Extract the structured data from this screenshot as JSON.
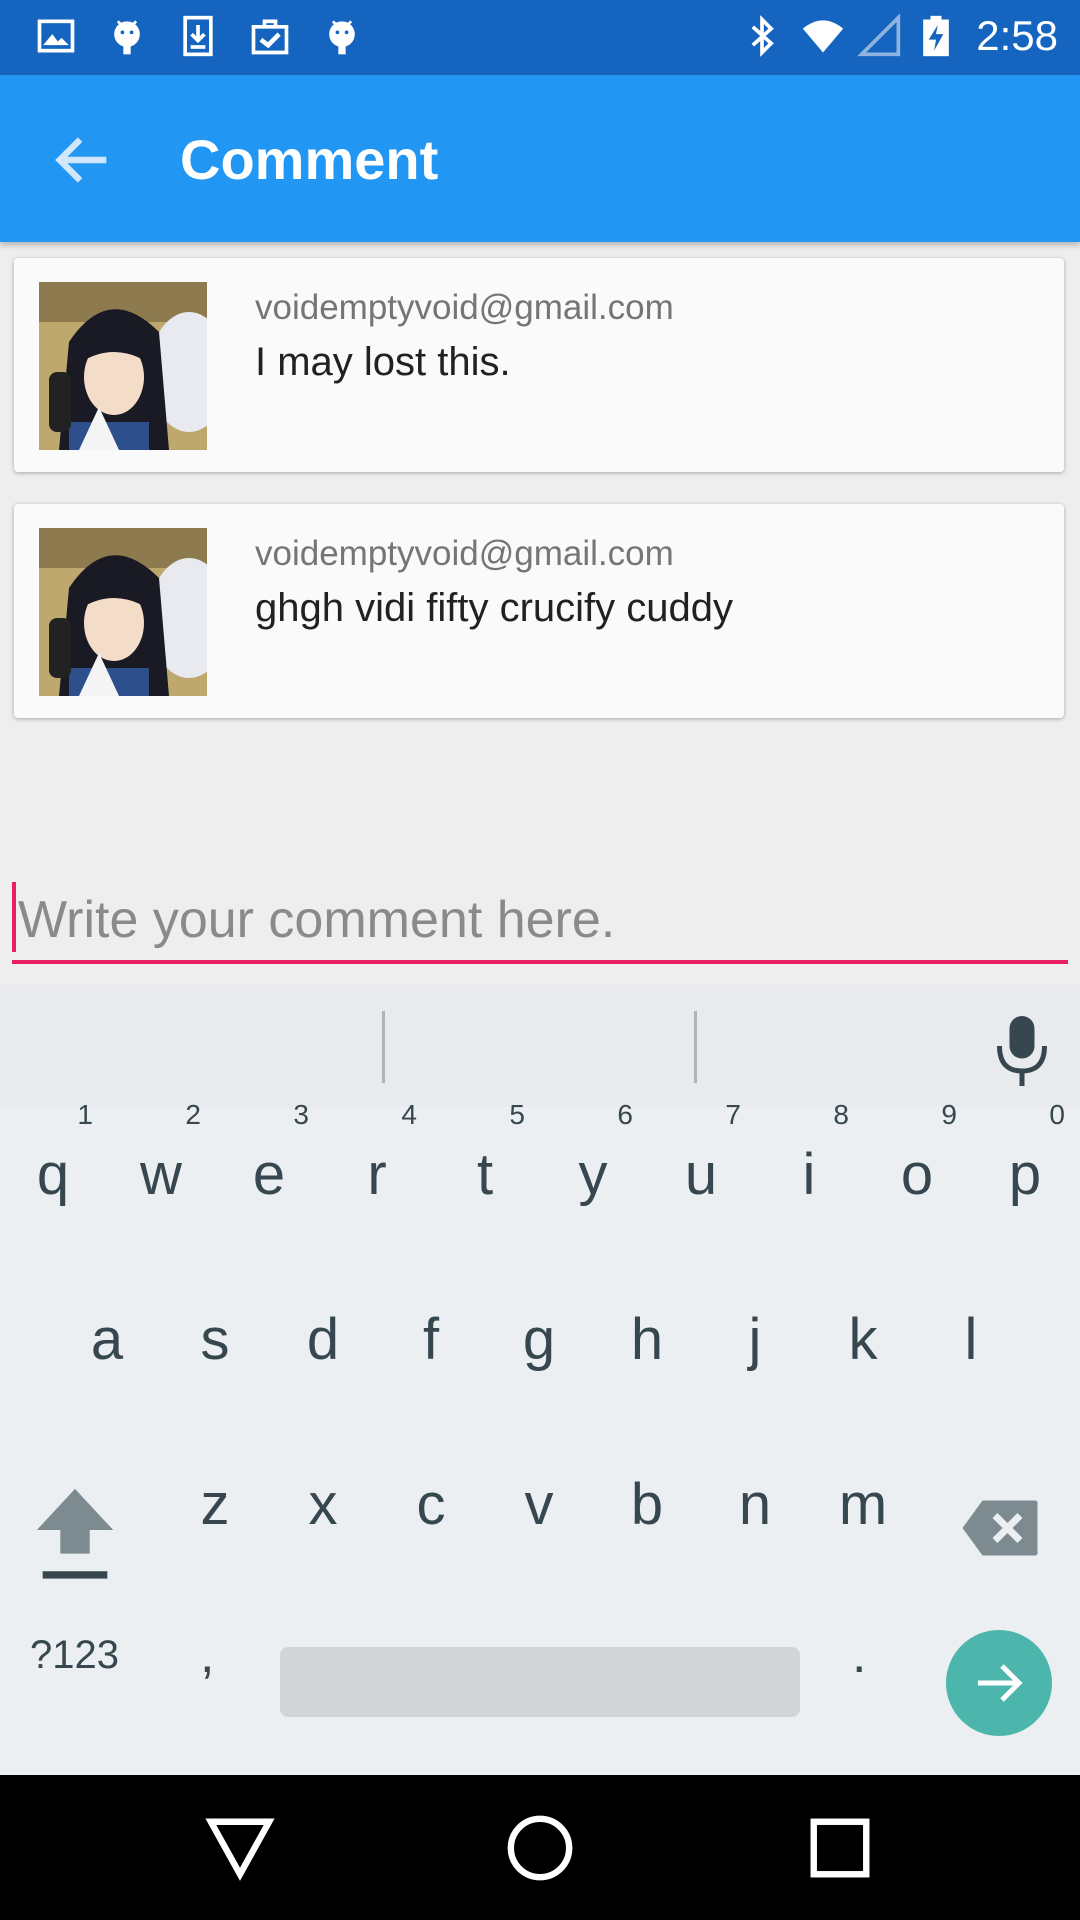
{
  "status_bar": {
    "time": "2:58",
    "left_icons": [
      "image-icon",
      "android-icon",
      "download-icon",
      "clipboard-check-icon",
      "android-icon"
    ],
    "right_icons": [
      "bluetooth-icon",
      "wifi-icon",
      "signal-icon",
      "battery-charging-icon"
    ],
    "color": "#1565c0"
  },
  "app_bar": {
    "title": "Comment",
    "color": "#2196f3"
  },
  "comments": [
    {
      "email": "voidemptyvoid@gmail.com",
      "text": "I may lost this."
    },
    {
      "email": "voidemptyvoid@gmail.com",
      "text": "ghgh vidi fifty crucify cuddy"
    }
  ],
  "comment_input": {
    "value": "",
    "placeholder": "Write your comment here.",
    "accent": "#e91e63"
  },
  "keyboard": {
    "row1": [
      "q",
      "w",
      "e",
      "r",
      "t",
      "y",
      "u",
      "i",
      "o",
      "p"
    ],
    "row1_hints": [
      "1",
      "2",
      "3",
      "4",
      "5",
      "6",
      "7",
      "8",
      "9",
      "0"
    ],
    "row2": [
      "a",
      "s",
      "d",
      "f",
      "g",
      "h",
      "j",
      "k",
      "l"
    ],
    "row3": [
      "z",
      "x",
      "c",
      "v",
      "b",
      "n",
      "m"
    ],
    "symbols_label": "?123",
    "comma": ",",
    "period": ".",
    "enter_color": "#4db6ac"
  },
  "nav_bar": {
    "buttons": [
      "back-icon",
      "home-icon",
      "recents-icon"
    ]
  }
}
